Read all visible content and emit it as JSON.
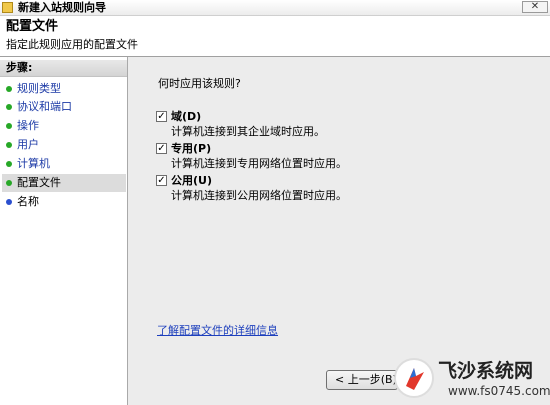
{
  "window": {
    "title": "新建入站规则向导",
    "close_glyph": "✕"
  },
  "header": {
    "title": "配置文件",
    "subtitle": "指定此规则应用的配置文件"
  },
  "steps": {
    "heading": "步骤:",
    "items": [
      {
        "label": "规则类型",
        "state": "done"
      },
      {
        "label": "协议和端口",
        "state": "done"
      },
      {
        "label": "操作",
        "state": "done"
      },
      {
        "label": "用户",
        "state": "done"
      },
      {
        "label": "计算机",
        "state": "done"
      },
      {
        "label": "配置文件",
        "state": "current"
      },
      {
        "label": "名称",
        "state": "todo"
      }
    ]
  },
  "main": {
    "question": "何时应用该规则?",
    "options": [
      {
        "label": "域(D)",
        "description": "计算机连接到其企业域时应用。",
        "checked": true
      },
      {
        "label": "专用(P)",
        "description": "计算机连接到专用网络位置时应用。",
        "checked": true
      },
      {
        "label": "公用(U)",
        "description": "计算机连接到公用网络位置时应用。",
        "checked": true
      }
    ],
    "link": "了解配置文件的详细信息",
    "back_button": "< 上一步(B)"
  },
  "watermark": {
    "name": "飞沙系统网",
    "url": "www.fs0745.com"
  },
  "colors": {
    "done_dot": "#27a827",
    "todo_dot": "#2a4fcf",
    "link": "#1d3fbd"
  }
}
